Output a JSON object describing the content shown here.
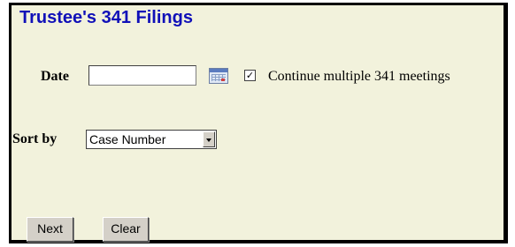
{
  "page": {
    "title": "Trustee's 341 Filings",
    "colors": {
      "title": "#1010b8",
      "background": "#f2f2dc"
    }
  },
  "form": {
    "date_label": "Date",
    "date_value": "",
    "date_icon": "calendar-icon",
    "continue_checked": true,
    "continue_label": "Continue multiple 341 meetings",
    "sort_label": "Sort by",
    "sort_selected": "Case Number"
  },
  "buttons": {
    "next": "Next",
    "clear": "Clear"
  }
}
